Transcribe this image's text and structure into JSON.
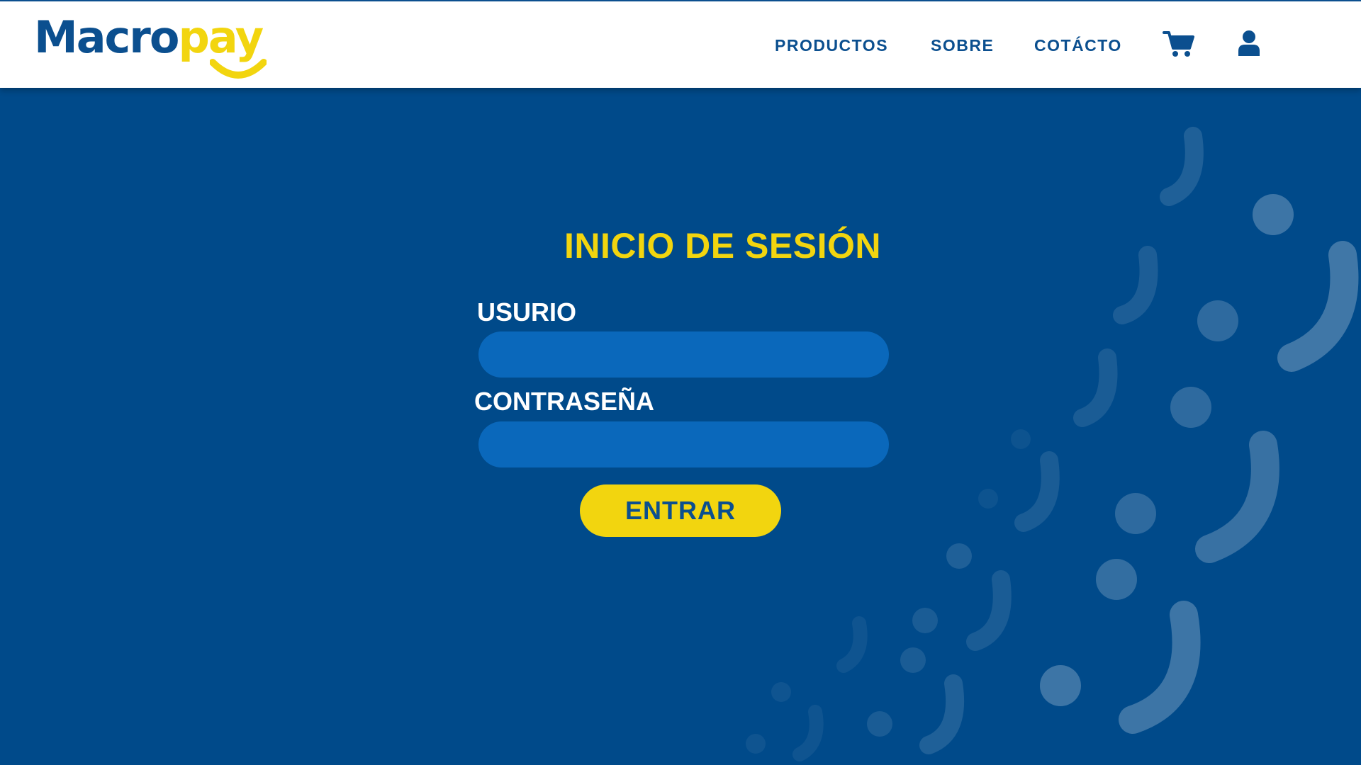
{
  "brand": {
    "name_part1": "Macro",
    "name_part2": "pay",
    "primary_color": "#0B4F8F",
    "accent_color": "#F2D50F"
  },
  "nav": {
    "items": [
      {
        "label": "PRODUCTOS"
      },
      {
        "label": "SOBRE"
      },
      {
        "label": "COTÁCTO"
      }
    ],
    "icons": [
      "cart-icon",
      "user-icon"
    ]
  },
  "login": {
    "title": "INICIO DE SESIÓN",
    "username_label": "USURIO",
    "username_value": "",
    "password_label": "CONTRASEÑA",
    "password_value": "",
    "submit_label": "ENTRAR"
  },
  "colors": {
    "background": "#004A8A",
    "input_fill": "#0A68BB",
    "title": "#F2D50F",
    "button": "#F2D50F",
    "header": "#FFFFFF"
  }
}
